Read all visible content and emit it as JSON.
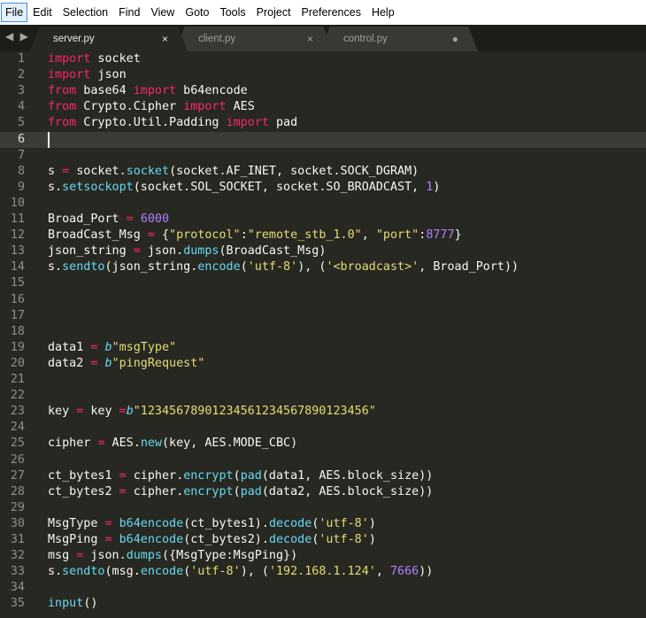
{
  "menu": [
    "File",
    "Edit",
    "Selection",
    "Find",
    "View",
    "Goto",
    "Tools",
    "Project",
    "Preferences",
    "Help"
  ],
  "nav_arrows": "◀ ▶",
  "tabs": [
    {
      "label": "server.py",
      "state": "×",
      "active": true
    },
    {
      "label": "client.py",
      "state": "×",
      "active": false
    },
    {
      "label": "control.py",
      "state": "●",
      "active": false
    }
  ],
  "colors": {
    "background": "#272822",
    "keyword": "#f92672",
    "function": "#66d9ef",
    "string": "#e6db74",
    "number": "#ae81ff",
    "text": "#f8f8f2"
  },
  "editor": {
    "current_line": 6,
    "lines": [
      [
        [
          "kw",
          "import"
        ],
        [
          "id",
          " socket"
        ]
      ],
      [
        [
          "kw",
          "import"
        ],
        [
          "id",
          " json"
        ]
      ],
      [
        [
          "kw",
          "from"
        ],
        [
          "id",
          " base64 "
        ],
        [
          "kw",
          "import"
        ],
        [
          "id",
          " b64encode"
        ]
      ],
      [
        [
          "kw",
          "from"
        ],
        [
          "id",
          " Crypto.Cipher "
        ],
        [
          "kw",
          "import"
        ],
        [
          "id",
          " AES"
        ]
      ],
      [
        [
          "kw",
          "from"
        ],
        [
          "id",
          " Crypto.Util.Padding "
        ],
        [
          "kw",
          "import"
        ],
        [
          "id",
          " pad"
        ]
      ],
      [],
      [],
      [
        [
          "id",
          "s "
        ],
        [
          "op",
          "="
        ],
        [
          "id",
          " socket."
        ],
        [
          "fn",
          "socket"
        ],
        [
          "id",
          "(socket.AF_INET, socket.SOCK_DGRAM)"
        ]
      ],
      [
        [
          "id",
          "s."
        ],
        [
          "fn",
          "setsockopt"
        ],
        [
          "id",
          "(socket.SOL_SOCKET, socket.SO_BROADCAST, "
        ],
        [
          "num",
          "1"
        ],
        [
          "id",
          ")"
        ]
      ],
      [],
      [
        [
          "id",
          "Broad_Port "
        ],
        [
          "op",
          "="
        ],
        [
          "id",
          " "
        ],
        [
          "num",
          "6000"
        ]
      ],
      [
        [
          "id",
          "BroadCast_Msg "
        ],
        [
          "op",
          "="
        ],
        [
          "id",
          " {"
        ],
        [
          "str",
          "\"protocol\""
        ],
        [
          "id",
          ":"
        ],
        [
          "str",
          "\"remote_stb_1.0\""
        ],
        [
          "id",
          ", "
        ],
        [
          "str",
          "\"port\""
        ],
        [
          "id",
          ":"
        ],
        [
          "num",
          "8777"
        ],
        [
          "id",
          "}"
        ]
      ],
      [
        [
          "id",
          "json_string "
        ],
        [
          "op",
          "="
        ],
        [
          "id",
          " json."
        ],
        [
          "fn",
          "dumps"
        ],
        [
          "id",
          "(BroadCast_Msg)"
        ]
      ],
      [
        [
          "id",
          "s."
        ],
        [
          "fn",
          "sendto"
        ],
        [
          "id",
          "(json_string."
        ],
        [
          "fn",
          "encode"
        ],
        [
          "id",
          "("
        ],
        [
          "str",
          "'utf-8'"
        ],
        [
          "id",
          "), ("
        ],
        [
          "str",
          "'<broadcast>'"
        ],
        [
          "id",
          ", Broad_Port))"
        ]
      ],
      [],
      [],
      [],
      [],
      [
        [
          "id",
          "data1 "
        ],
        [
          "op",
          "="
        ],
        [
          "id",
          " "
        ],
        [
          "pre",
          "b"
        ],
        [
          "str",
          "\"msgType\""
        ]
      ],
      [
        [
          "id",
          "data2 "
        ],
        [
          "op",
          "="
        ],
        [
          "id",
          " "
        ],
        [
          "pre",
          "b"
        ],
        [
          "str",
          "\"pingRequest\""
        ]
      ],
      [],
      [],
      [
        [
          "id",
          "key "
        ],
        [
          "op",
          "="
        ],
        [
          "id",
          " key "
        ],
        [
          "op",
          "="
        ],
        [
          "pre",
          "b"
        ],
        [
          "str",
          "\"12345678901234561234567890123456\""
        ]
      ],
      [],
      [
        [
          "id",
          "cipher "
        ],
        [
          "op",
          "="
        ],
        [
          "id",
          " AES."
        ],
        [
          "fn",
          "new"
        ],
        [
          "id",
          "(key, AES.MODE_CBC)"
        ]
      ],
      [],
      [
        [
          "id",
          "ct_bytes1 "
        ],
        [
          "op",
          "="
        ],
        [
          "id",
          " cipher."
        ],
        [
          "fn",
          "encrypt"
        ],
        [
          "id",
          "("
        ],
        [
          "fn",
          "pad"
        ],
        [
          "id",
          "(data1, AES.block_size))"
        ]
      ],
      [
        [
          "id",
          "ct_bytes2 "
        ],
        [
          "op",
          "="
        ],
        [
          "id",
          " cipher."
        ],
        [
          "fn",
          "encrypt"
        ],
        [
          "id",
          "("
        ],
        [
          "fn",
          "pad"
        ],
        [
          "id",
          "(data2, AES.block_size))"
        ]
      ],
      [],
      [
        [
          "id",
          "MsgType "
        ],
        [
          "op",
          "="
        ],
        [
          "id",
          " "
        ],
        [
          "fn",
          "b64encode"
        ],
        [
          "id",
          "(ct_bytes1)."
        ],
        [
          "fn",
          "decode"
        ],
        [
          "id",
          "("
        ],
        [
          "str",
          "'utf-8'"
        ],
        [
          "id",
          ")"
        ]
      ],
      [
        [
          "id",
          "MsgPing "
        ],
        [
          "op",
          "="
        ],
        [
          "id",
          " "
        ],
        [
          "fn",
          "b64encode"
        ],
        [
          "id",
          "(ct_bytes2)."
        ],
        [
          "fn",
          "decode"
        ],
        [
          "id",
          "("
        ],
        [
          "str",
          "'utf-8'"
        ],
        [
          "id",
          ")"
        ]
      ],
      [
        [
          "id",
          "msg "
        ],
        [
          "op",
          "="
        ],
        [
          "id",
          " json."
        ],
        [
          "fn",
          "dumps"
        ],
        [
          "id",
          "({MsgType:MsgPing})"
        ]
      ],
      [
        [
          "id",
          "s."
        ],
        [
          "fn",
          "sendto"
        ],
        [
          "id",
          "(msg."
        ],
        [
          "fn",
          "encode"
        ],
        [
          "id",
          "("
        ],
        [
          "str",
          "'utf-8'"
        ],
        [
          "id",
          "), ("
        ],
        [
          "str",
          "'192.168.1.124'"
        ],
        [
          "id",
          ", "
        ],
        [
          "num",
          "7666"
        ],
        [
          "id",
          "))"
        ]
      ],
      [],
      [
        [
          "fn",
          "input"
        ],
        [
          "id",
          "()"
        ]
      ]
    ]
  }
}
